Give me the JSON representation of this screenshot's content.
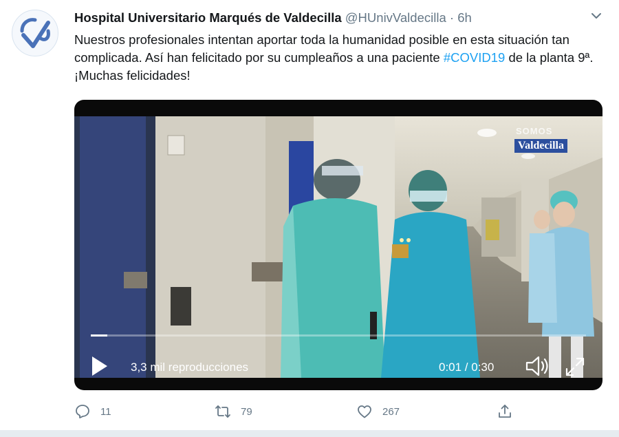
{
  "account": {
    "name": "Hospital Universitario Marqués de Valdecilla",
    "handle": "@HUnivValdecilla",
    "separator": "·",
    "time": "6h"
  },
  "tweet": {
    "text_before": "Nuestros profesionales intentan aportar toda la humanidad posible en esta situación tan complicada. Así han felicitado por su cumpleaños a una paciente ",
    "hashtag": "#COVID19",
    "text_after": " de la planta 9ª. ¡Muchas felicidades!"
  },
  "video": {
    "watermark_top": "SOMOS",
    "watermark_label": "Valdecilla",
    "views": "3,3 mil reproducciones",
    "time_display": "0:01 / 0:30",
    "progress": 0.033
  },
  "actions": {
    "reply_count": "11",
    "retweet_count": "79",
    "like_count": "267"
  },
  "colors": {
    "accent": "#1da1f2",
    "muted": "#657786",
    "logo": "#4a72b8"
  },
  "icons": [
    "logo-icon",
    "chevron-down-icon",
    "play-icon",
    "volume-icon",
    "fullscreen-icon",
    "reply-icon",
    "retweet-icon",
    "like-icon",
    "share-icon"
  ]
}
